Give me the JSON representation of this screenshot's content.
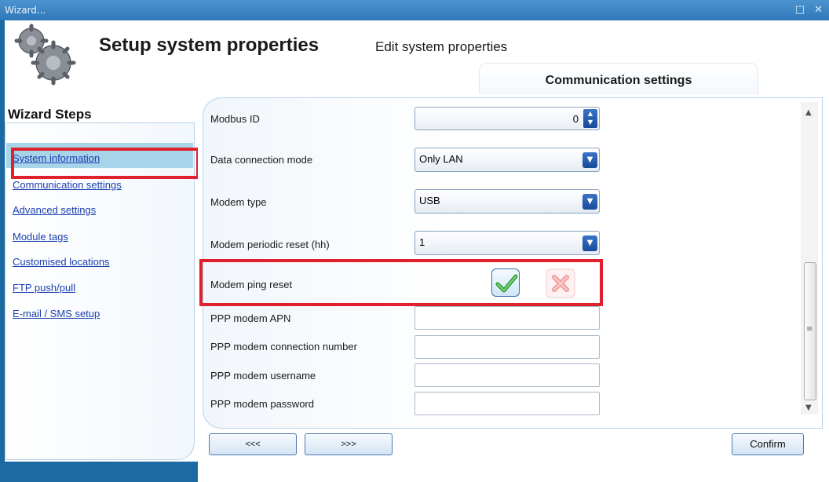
{
  "window": {
    "title": "Wizard...",
    "controls": "□ ✕"
  },
  "header": {
    "title": "Setup system properties",
    "subtitle": "Edit system properties",
    "active_tab": "Communication settings"
  },
  "sidebar": {
    "title": "Wizard Steps",
    "selected_index": 1,
    "items": [
      {
        "label": "System information"
      },
      {
        "label": "Communication settings"
      },
      {
        "label": "Advanced settings"
      },
      {
        "label": "Module tags"
      },
      {
        "label": "Customised locations"
      },
      {
        "label": "FTP push/pull"
      },
      {
        "label": "E-mail / SMS setup"
      }
    ]
  },
  "form": {
    "modbus_id": {
      "label": "Modbus ID",
      "value": "0"
    },
    "data_connection_mode": {
      "label": "Data connection mode",
      "value": "Only LAN"
    },
    "modem_type": {
      "label": "Modem type",
      "value": "USB"
    },
    "modem_periodic_reset": {
      "label": "Modem periodic reset (hh)",
      "value": "1"
    },
    "modem_ping_reset": {
      "label": "Modem ping reset",
      "enabled": true
    },
    "ppp_apn": {
      "label": "PPP modem APN",
      "value": ""
    },
    "ppp_connection_number": {
      "label": "PPP modem connection number",
      "value": ""
    },
    "ppp_username": {
      "label": "PPP modem username",
      "value": ""
    },
    "ppp_password": {
      "label": "PPP modem password",
      "value": ""
    }
  },
  "footer": {
    "back_label": "<<<",
    "next_label": ">>>",
    "confirm_label": "Confirm"
  },
  "colors": {
    "highlight_red": "#e0202c",
    "selected_step": "#a7d4e8",
    "accent_blue": "#1d6aa3"
  },
  "icons": {
    "header": "gears-icon",
    "check": "checkmark-icon",
    "cross": "cross-icon"
  }
}
